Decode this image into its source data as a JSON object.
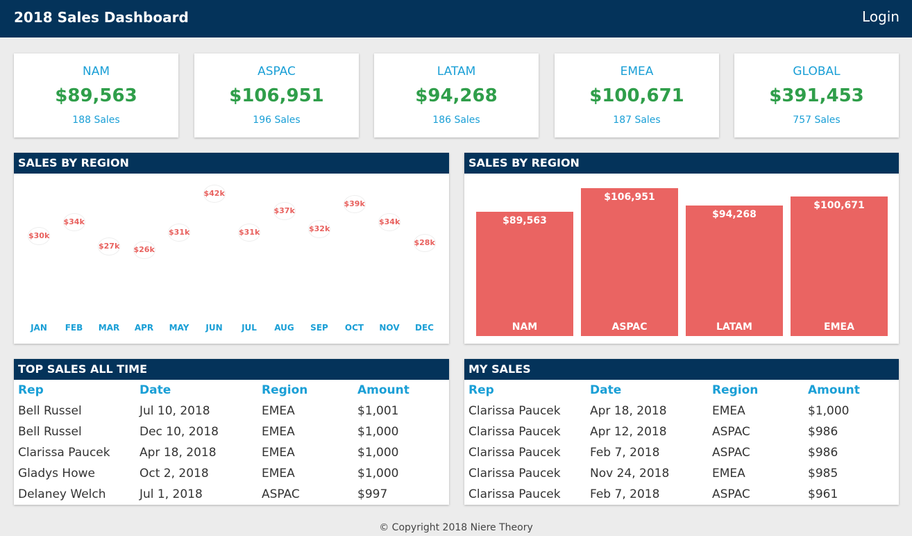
{
  "header": {
    "title": "2018 Sales Dashboard",
    "login": "Login"
  },
  "kpis": [
    {
      "region": "NAM",
      "amount": "$89,563",
      "sales": "188 Sales"
    },
    {
      "region": "ASPAC",
      "amount": "$106,951",
      "sales": "196 Sales"
    },
    {
      "region": "LATAM",
      "amount": "$94,268",
      "sales": "186 Sales"
    },
    {
      "region": "EMEA",
      "amount": "$100,671",
      "sales": "187 Sales"
    },
    {
      "region": "GLOBAL",
      "amount": "$391,453",
      "sales": "757 Sales"
    }
  ],
  "panels": {
    "scatter_title": "SALES BY REGION",
    "bars_title": "SALES BY REGION",
    "top_title": "TOP SALES ALL TIME",
    "mine_title": "MY SALES"
  },
  "chart_data": [
    {
      "type": "scatter",
      "title": "SALES BY REGION",
      "categories": [
        "JAN",
        "FEB",
        "MAR",
        "APR",
        "MAY",
        "JUN",
        "JUL",
        "AUG",
        "SEP",
        "OCT",
        "NOV",
        "DEC"
      ],
      "values": [
        30,
        34,
        27,
        26,
        31,
        42,
        31,
        37,
        32,
        39,
        34,
        28
      ],
      "labels": [
        "$30k",
        "$34k",
        "$27k",
        "$26k",
        "$31k",
        "$42k",
        "$31k",
        "$37k",
        "$32k",
        "$39k",
        "$34k",
        "$28k"
      ],
      "grid": false,
      "color": "#e8615e"
    },
    {
      "type": "bar",
      "title": "SALES BY REGION",
      "categories": [
        "NAM",
        "ASPAC",
        "LATAM",
        "EMEA"
      ],
      "values": [
        89563,
        106951,
        94268,
        100671
      ],
      "labels": [
        "$89,563",
        "$106,951",
        "$94,268",
        "$100,671"
      ],
      "color": "#ea6462"
    }
  ],
  "tables": {
    "columns": [
      "Rep",
      "Date",
      "Region",
      "Amount"
    ],
    "top": [
      [
        "Bell Russel",
        "Jul 10, 2018",
        "EMEA",
        "$1,001"
      ],
      [
        "Bell Russel",
        "Dec 10, 2018",
        "EMEA",
        "$1,000"
      ],
      [
        "Clarissa Paucek",
        "Apr 18, 2018",
        "EMEA",
        "$1,000"
      ],
      [
        "Gladys Howe",
        "Oct 2, 2018",
        "EMEA",
        "$1,000"
      ],
      [
        "Delaney Welch",
        "Jul 1, 2018",
        "ASPAC",
        "$997"
      ]
    ],
    "mine": [
      [
        "Clarissa Paucek",
        "Apr 18, 2018",
        "EMEA",
        "$1,000"
      ],
      [
        "Clarissa Paucek",
        "Apr 12, 2018",
        "ASPAC",
        "$986"
      ],
      [
        "Clarissa Paucek",
        "Feb 7, 2018",
        "ASPAC",
        "$986"
      ],
      [
        "Clarissa Paucek",
        "Nov 24, 2018",
        "EMEA",
        "$985"
      ],
      [
        "Clarissa Paucek",
        "Feb 7, 2018",
        "ASPAC",
        "$961"
      ]
    ]
  },
  "colors": {
    "navy": "#04335a",
    "blue": "#1a9fd6",
    "green": "#2f9e4a",
    "red": "#ea6462"
  },
  "footer": "© Copyright 2018 Niere Theory"
}
